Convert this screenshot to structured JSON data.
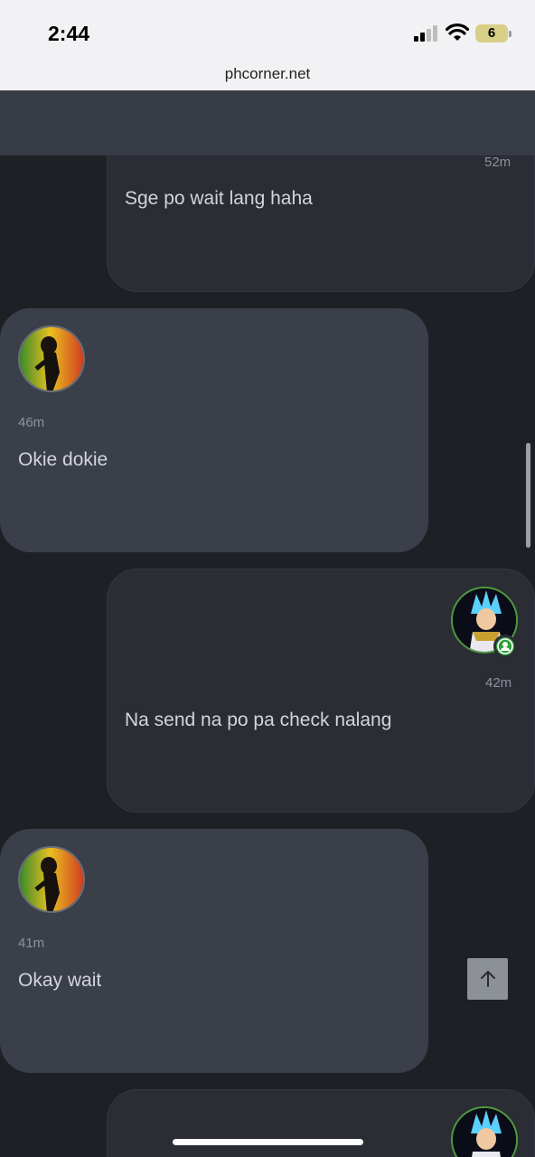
{
  "status_bar": {
    "time": "2:44",
    "battery": "6",
    "url": "phcorner.net"
  },
  "navbar": {
    "icons": [
      "menu-icon",
      "logo",
      "user-avatar",
      "mail-icon",
      "bell-icon",
      "bolt-icon",
      "search-icon"
    ]
  },
  "messages": [
    {
      "side": "mine",
      "time": "52m",
      "text": "Sge po wait lang haha"
    },
    {
      "side": "theirs",
      "time": "46m",
      "text": "Okie dokie"
    },
    {
      "side": "mine",
      "time": "42m",
      "text": "Na send na po pa check nalang"
    },
    {
      "side": "theirs",
      "time": "41m",
      "text": "Okay wait"
    },
    {
      "side": "mine",
      "time": "",
      "text": ""
    }
  ],
  "colors": {
    "background": "#1f2026",
    "navbar": "#373b45",
    "mine_bubble": "#2b2d35",
    "theirs_bubble": "#3a3f4a",
    "online": "#2f9f3a"
  }
}
